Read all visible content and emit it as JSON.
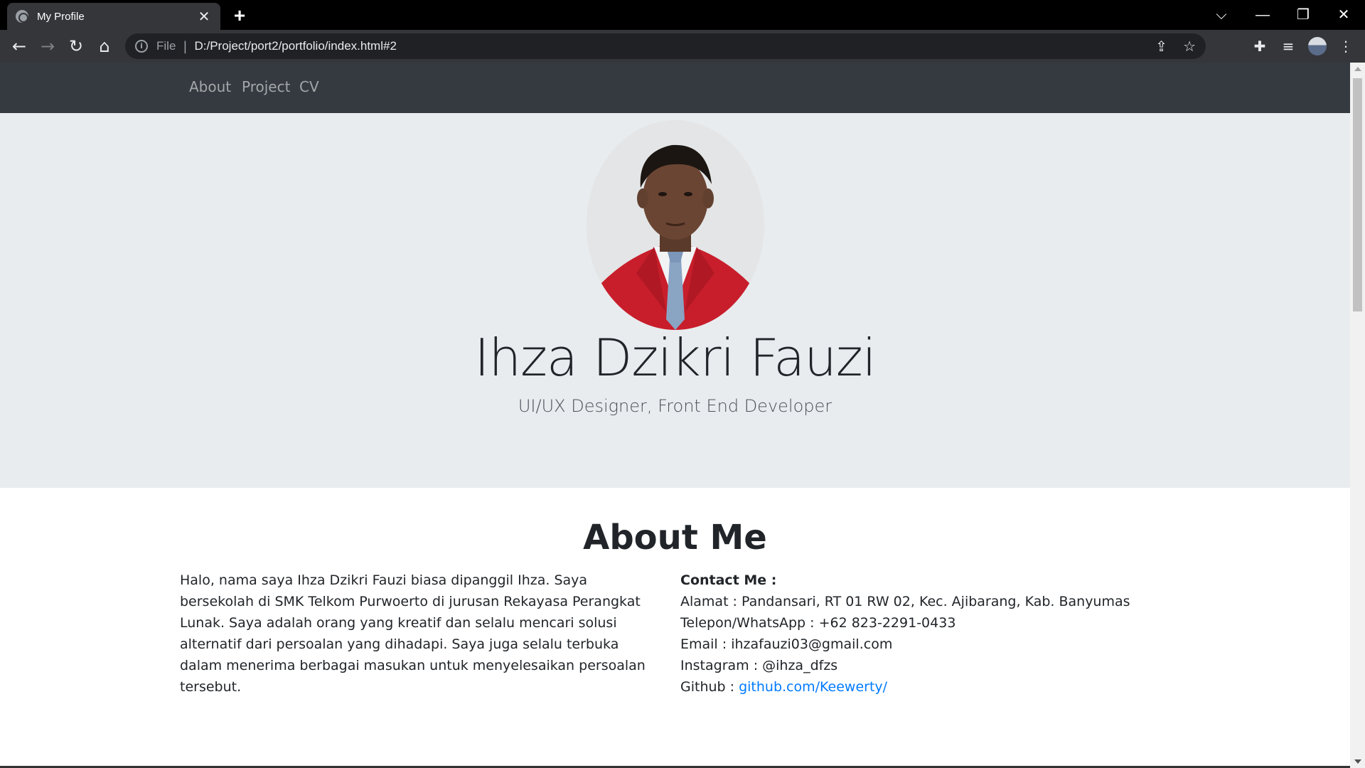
{
  "browser": {
    "tab_title": "My Profile",
    "tab_close": "✕",
    "new_tab": "+",
    "scheme": "File",
    "url": "D:/Project/port2/portfolio/index.html#2"
  },
  "nav": {
    "items": [
      {
        "label": "About"
      },
      {
        "label": "Project"
      },
      {
        "label": "CV"
      }
    ]
  },
  "hero": {
    "name": "Ihza Dzikri Fauzi",
    "subtitle": "UI/UX Designer, Front End Developer"
  },
  "about": {
    "heading": "About Me",
    "bio": "Halo, nama saya Ihza Dzikri Fauzi biasa dipanggil Ihza. Saya bersekolah di SMK Telkom Purwoerto di jurusan Rekayasa Perangkat Lunak. Saya adalah orang yang kreatif dan selalu mencari solusi alternatif dari persoalan yang dihadapi. Saya juga selalu terbuka dalam menerima berbagai masukan untuk menyelesaikan persoalan tersebut.",
    "contact": {
      "heading": "Contact Me :",
      "alamat": "Alamat : Pandansari, RT 01 RW 02, Kec. Ajibarang, Kab. Banyumas",
      "telepon": "Telepon/WhatsApp : +62 823-2291-0433",
      "email": "Email : ihzafauzi03@gmail.com",
      "instagram": "Instagram : @ihza_dfzs",
      "github_label": "Github : ",
      "github_link": "github.com/Keewerty/"
    }
  },
  "colors": {
    "navbar": "#343a40",
    "hero_bg": "#e9ecef",
    "link": "#007bff",
    "jacket": "#c81e2b"
  }
}
